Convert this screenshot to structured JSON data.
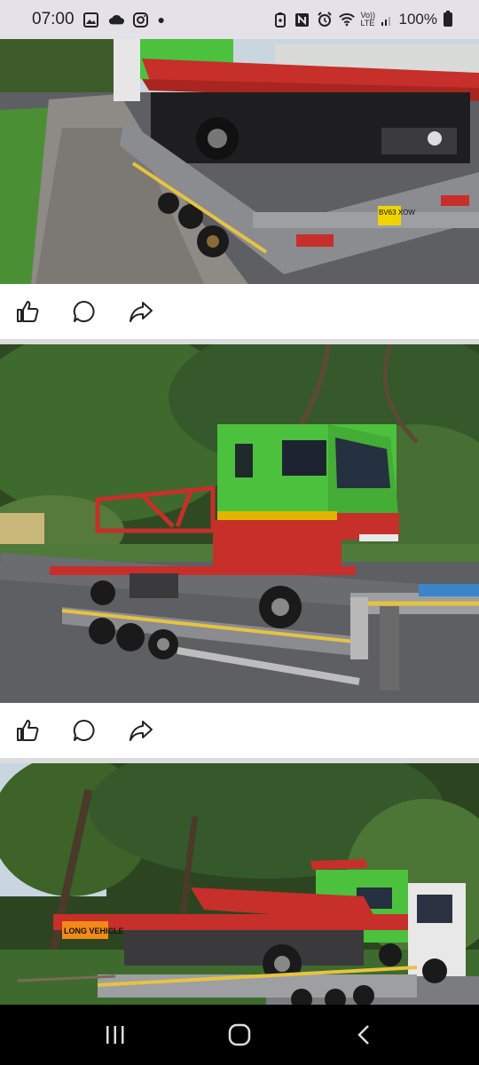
{
  "status_bar": {
    "time": "07:00",
    "battery": "100%",
    "notif_icons": [
      "image-icon",
      "cloud-icon",
      "instagram-icon",
      "dot-icon"
    ],
    "system_icons": [
      "battery-saver-icon",
      "nfc-icon",
      "alarm-icon",
      "wifi-icon",
      "volte-signal-icon",
      "battery-icon"
    ],
    "volte_label": "Vo)) LTE"
  },
  "posts": [
    {
      "plate_text": "BV63 XOW",
      "actions": [
        "like",
        "comment",
        "share"
      ]
    },
    {
      "actions": [
        "like",
        "comment",
        "share"
      ]
    },
    {
      "sign_text": "LONG VEHICLE"
    }
  ],
  "nav_bar": {
    "buttons": [
      "recents",
      "home",
      "back"
    ]
  },
  "colors": {
    "cab_green": "#4cc13d",
    "bed_red": "#c62f2a",
    "trailer_grey": "#8a8c90",
    "tarmac": "#5d5f63",
    "foliage": "#2f4a22",
    "sky": "#c9d6df"
  }
}
